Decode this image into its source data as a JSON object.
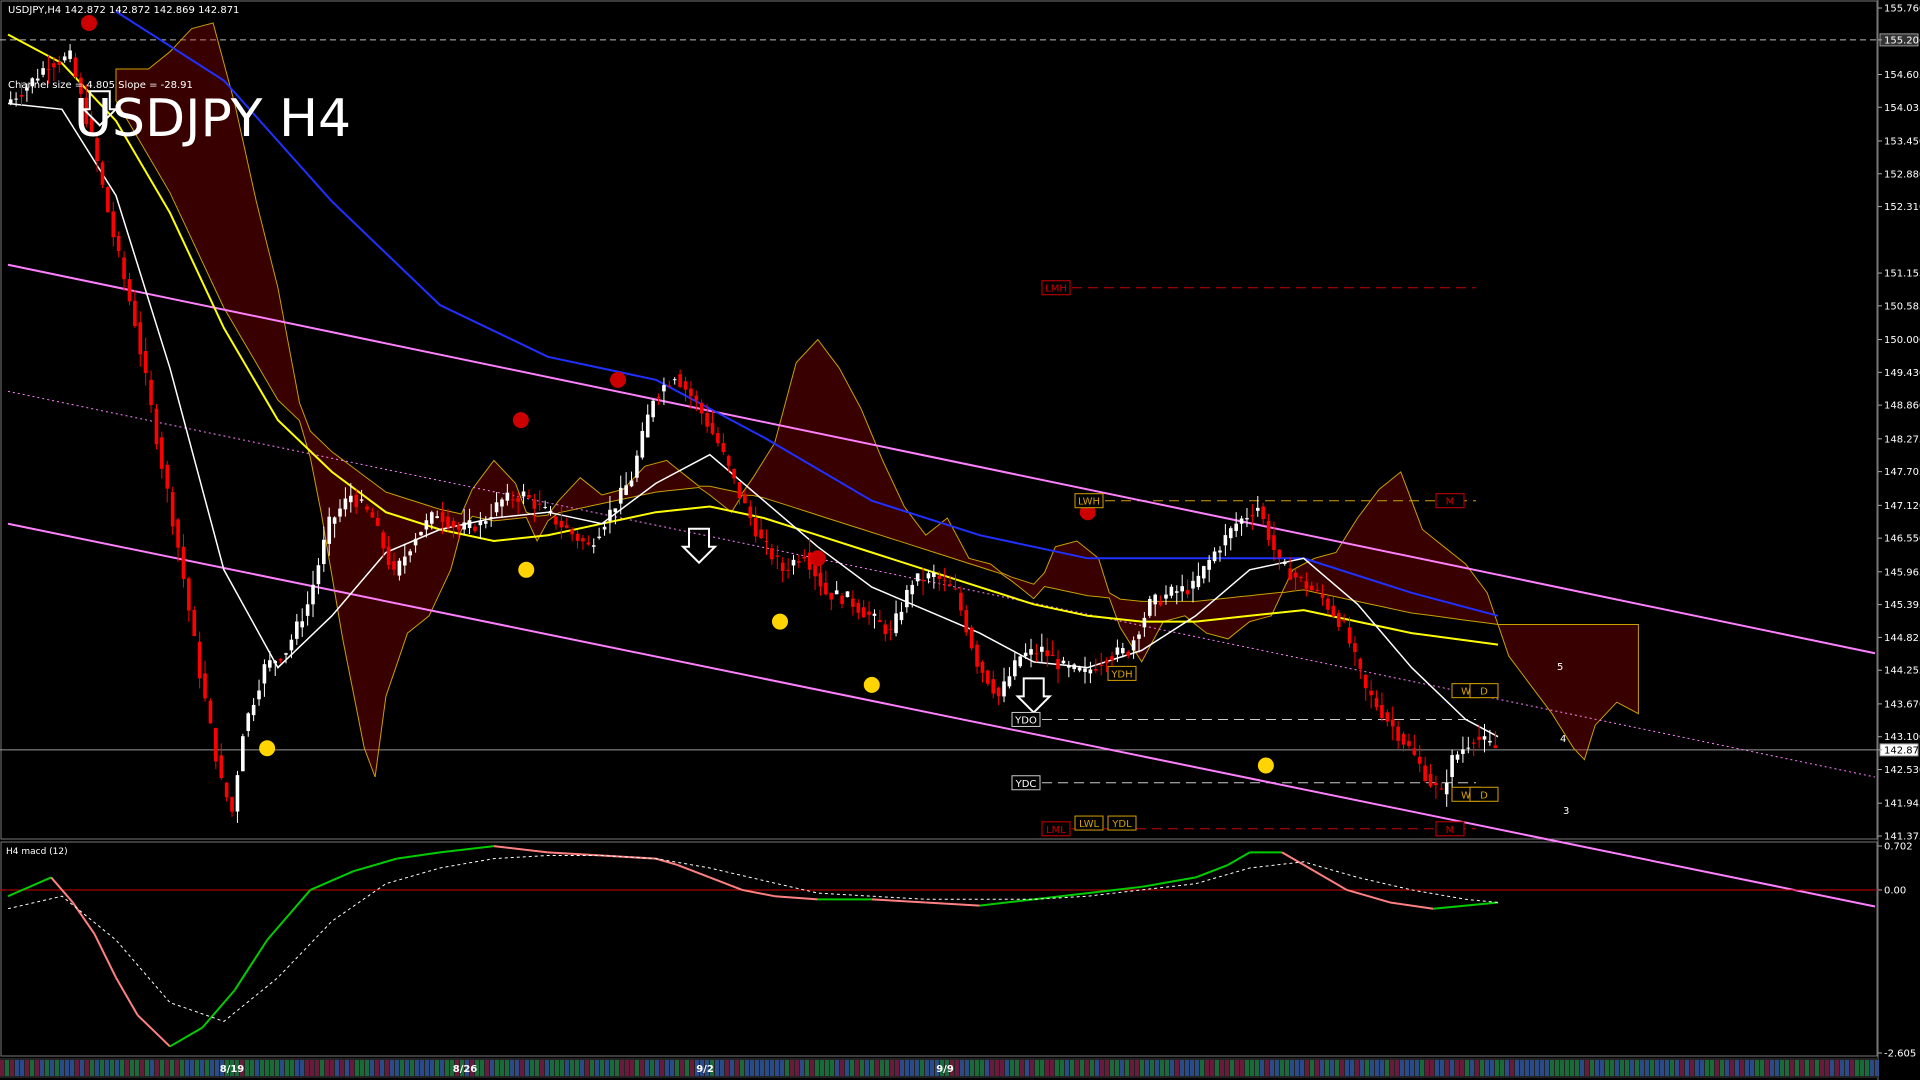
{
  "header": {
    "symbol_line": "USDJPY,H4  142.872 142.872 142.869 142.871",
    "channel_line": "Channel size = 4.805 Slope = -28.91",
    "big_title": "USDJPY H4"
  },
  "macd_panel": {
    "label": "H4  macd (12)"
  },
  "colors": {
    "background": "#000000",
    "bull_candle": "#ffffff",
    "bear_candle": "#ff0000",
    "ma_fast": "#ffffff",
    "ma_slow": "#ffff00",
    "ma_long": "#0000ff",
    "channel": "#ff80ff",
    "cloud": "#cc0000",
    "macd_up": "#00cc00",
    "macd_down": "#ff8080",
    "signal": "#ffffff",
    "axis_text": "#ffffff"
  },
  "chart_data": [
    {
      "type": "candlestick",
      "title": "USDJPY H4",
      "ylim": [
        141.375,
        155.76
      ],
      "current_price": 142.871,
      "price_axis_labels": [
        "155.760",
        "155.206",
        "154.605",
        "154.035",
        "153.450",
        "152.880",
        "152.310",
        "151.155",
        "150.585",
        "150.000",
        "149.430",
        "148.860",
        "148.275",
        "147.705",
        "147.120",
        "146.550",
        "145.965",
        "145.395",
        "144.825",
        "144.255",
        "143.670",
        "143.100",
        "142.871",
        "142.530",
        "141.945",
        "141.375"
      ],
      "highlighted_levels": [
        {
          "value": "155.206",
          "style": "dashed"
        },
        {
          "value": "142.871",
          "style": "current"
        }
      ],
      "date_labels": [
        "8/19",
        "8/26",
        "9/2",
        "9/9"
      ],
      "price_path": [
        [
          0,
          154.1
        ],
        [
          4,
          154.4
        ],
        [
          8,
          154.8
        ],
        [
          12,
          154.9
        ],
        [
          16,
          153.5
        ],
        [
          20,
          151.8
        ],
        [
          24,
          150.3
        ],
        [
          28,
          148.3
        ],
        [
          32,
          146.4
        ],
        [
          36,
          144.2
        ],
        [
          40,
          142.3
        ],
        [
          42,
          141.8
        ],
        [
          44,
          143.2
        ],
        [
          48,
          144.3
        ],
        [
          52,
          144.6
        ],
        [
          56,
          145.4
        ],
        [
          60,
          146.8
        ],
        [
          64,
          147.3
        ],
        [
          68,
          146.9
        ],
        [
          72,
          145.9
        ],
        [
          76,
          146.6
        ],
        [
          80,
          147.0
        ],
        [
          84,
          146.7
        ],
        [
          88,
          146.8
        ],
        [
          92,
          147.2
        ],
        [
          96,
          147.3
        ],
        [
          100,
          147.0
        ],
        [
          104,
          146.7
        ],
        [
          108,
          146.4
        ],
        [
          112,
          147.0
        ],
        [
          116,
          147.6
        ],
        [
          120,
          149.0
        ],
        [
          124,
          149.4
        ],
        [
          128,
          148.9
        ],
        [
          132,
          148.2
        ],
        [
          136,
          147.3
        ],
        [
          140,
          146.5
        ],
        [
          144,
          146.0
        ],
        [
          148,
          146.3
        ],
        [
          152,
          145.6
        ],
        [
          156,
          145.5
        ],
        [
          160,
          145.2
        ],
        [
          164,
          144.9
        ],
        [
          168,
          145.8
        ],
        [
          172,
          145.9
        ],
        [
          176,
          145.6
        ],
        [
          180,
          144.4
        ],
        [
          184,
          143.8
        ],
        [
          188,
          144.5
        ],
        [
          192,
          144.6
        ],
        [
          196,
          144.3
        ],
        [
          200,
          144.2
        ],
        [
          204,
          144.5
        ],
        [
          208,
          144.6
        ],
        [
          212,
          145.4
        ],
        [
          216,
          145.6
        ],
        [
          220,
          145.7
        ],
        [
          224,
          146.3
        ],
        [
          228,
          146.8
        ],
        [
          232,
          147.1
        ],
        [
          236,
          146.1
        ],
        [
          240,
          145.8
        ],
        [
          244,
          145.5
        ],
        [
          248,
          145.0
        ],
        [
          252,
          143.9
        ],
        [
          256,
          143.4
        ],
        [
          260,
          142.9
        ],
        [
          264,
          142.3
        ],
        [
          266,
          142.1
        ],
        [
          268,
          142.7
        ],
        [
          272,
          143.1
        ],
        [
          276,
          142.9
        ]
      ],
      "ma_fast": [
        [
          0,
          154.1
        ],
        [
          10,
          154.0
        ],
        [
          20,
          152.5
        ],
        [
          30,
          149.5
        ],
        [
          40,
          146.0
        ],
        [
          50,
          144.3
        ],
        [
          60,
          145.2
        ],
        [
          70,
          146.3
        ],
        [
          80,
          146.7
        ],
        [
          90,
          146.9
        ],
        [
          100,
          147.0
        ],
        [
          110,
          146.8
        ],
        [
          120,
          147.5
        ],
        [
          130,
          148.0
        ],
        [
          140,
          147.2
        ],
        [
          150,
          146.4
        ],
        [
          160,
          145.7
        ],
        [
          170,
          145.3
        ],
        [
          180,
          144.9
        ],
        [
          190,
          144.4
        ],
        [
          200,
          144.3
        ],
        [
          210,
          144.6
        ],
        [
          220,
          145.2
        ],
        [
          230,
          146.0
        ],
        [
          240,
          146.2
        ],
        [
          250,
          145.4
        ],
        [
          260,
          144.3
        ],
        [
          270,
          143.4
        ],
        [
          276,
          143.1
        ]
      ],
      "ma_slow": [
        [
          0,
          155.3
        ],
        [
          10,
          154.8
        ],
        [
          20,
          153.8
        ],
        [
          30,
          152.2
        ],
        [
          40,
          150.2
        ],
        [
          50,
          148.6
        ],
        [
          60,
          147.7
        ],
        [
          70,
          147.0
        ],
        [
          80,
          146.7
        ],
        [
          90,
          146.5
        ],
        [
          100,
          146.6
        ],
        [
          110,
          146.8
        ],
        [
          120,
          147.0
        ],
        [
          130,
          147.1
        ],
        [
          140,
          146.9
        ],
        [
          150,
          146.6
        ],
        [
          160,
          146.3
        ],
        [
          170,
          146.0
        ],
        [
          180,
          145.7
        ],
        [
          190,
          145.4
        ],
        [
          200,
          145.2
        ],
        [
          210,
          145.1
        ],
        [
          220,
          145.1
        ],
        [
          230,
          145.2
        ],
        [
          240,
          145.3
        ],
        [
          250,
          145.1
        ],
        [
          260,
          144.9
        ],
        [
          276,
          144.7
        ]
      ],
      "ma_long": [
        [
          20,
          155.7
        ],
        [
          40,
          154.5
        ],
        [
          60,
          152.4
        ],
        [
          80,
          150.6
        ],
        [
          100,
          149.7
        ],
        [
          120,
          149.3
        ],
        [
          140,
          148.3
        ],
        [
          160,
          147.2
        ],
        [
          180,
          146.6
        ],
        [
          200,
          146.2
        ],
        [
          220,
          146.2
        ],
        [
          240,
          146.2
        ],
        [
          260,
          145.6
        ],
        [
          276,
          145.2
        ]
      ],
      "channel_upper": [
        [
          0,
          151.3
        ],
        [
          276,
          144.9
        ]
      ],
      "channel_lower": [
        [
          0,
          146.8
        ],
        [
          276,
          140.5
        ]
      ],
      "channel_mid": [
        [
          0,
          149.1
        ],
        [
          276,
          142.7
        ]
      ],
      "annotations": [
        {
          "text": "LMH",
          "value": 150.9
        },
        {
          "text": "LWH",
          "value": 147.2
        },
        {
          "text": "M",
          "value": 147.2
        },
        {
          "text": "YDH",
          "value": 144.2
        },
        {
          "text": "YDO",
          "value": 143.4
        },
        {
          "text": "W",
          "value": 143.9
        },
        {
          "text": "D",
          "value": 143.9
        },
        {
          "text": "YDC",
          "value": 142.3
        },
        {
          "text": "W",
          "value": 142.1
        },
        {
          "text": "D",
          "value": 142.1
        },
        {
          "text": "LWL",
          "value": 141.6
        },
        {
          "text": "YDL",
          "value": 141.6
        },
        {
          "text": "LML",
          "value": 141.5
        },
        {
          "text": "M",
          "value": 141.5
        }
      ],
      "extra_labels": [
        "5",
        "4",
        "3"
      ]
    },
    {
      "type": "line",
      "title": "H4  macd (12)",
      "ylim": [
        -2.605,
        0.702
      ],
      "axis_labels": [
        "0.702",
        "0.00",
        "-2.605"
      ],
      "macd": [
        [
          0,
          -0.1
        ],
        [
          8,
          0.2
        ],
        [
          12,
          -0.2
        ],
        [
          16,
          -0.7
        ],
        [
          20,
          -1.4
        ],
        [
          24,
          -2.0
        ],
        [
          30,
          -2.5
        ],
        [
          36,
          -2.2
        ],
        [
          42,
          -1.6
        ],
        [
          48,
          -0.8
        ],
        [
          56,
          0.0
        ],
        [
          64,
          0.3
        ],
        [
          72,
          0.5
        ],
        [
          80,
          0.6
        ],
        [
          90,
          0.7
        ],
        [
          100,
          0.6
        ],
        [
          110,
          0.55
        ],
        [
          120,
          0.5
        ],
        [
          124,
          0.4
        ],
        [
          130,
          0.2
        ],
        [
          136,
          0.0
        ],
        [
          142,
          -0.1
        ],
        [
          150,
          -0.15
        ],
        [
          160,
          -0.15
        ],
        [
          170,
          -0.2
        ],
        [
          180,
          -0.25
        ],
        [
          190,
          -0.15
        ],
        [
          200,
          -0.05
        ],
        [
          210,
          0.05
        ],
        [
          220,
          0.2
        ],
        [
          226,
          0.4
        ],
        [
          230,
          0.6
        ],
        [
          236,
          0.6
        ],
        [
          242,
          0.3
        ],
        [
          248,
          0.0
        ],
        [
          256,
          -0.2
        ],
        [
          264,
          -0.3
        ],
        [
          270,
          -0.25
        ],
        [
          276,
          -0.2
        ]
      ],
      "signal": [
        [
          0,
          -0.3
        ],
        [
          10,
          -0.1
        ],
        [
          20,
          -0.8
        ],
        [
          30,
          -1.8
        ],
        [
          40,
          -2.1
        ],
        [
          50,
          -1.4
        ],
        [
          60,
          -0.5
        ],
        [
          70,
          0.1
        ],
        [
          80,
          0.35
        ],
        [
          90,
          0.5
        ],
        [
          100,
          0.55
        ],
        [
          110,
          0.55
        ],
        [
          120,
          0.5
        ],
        [
          130,
          0.35
        ],
        [
          140,
          0.15
        ],
        [
          150,
          -0.05
        ],
        [
          160,
          -0.1
        ],
        [
          170,
          -0.15
        ],
        [
          180,
          -0.15
        ],
        [
          190,
          -0.15
        ],
        [
          200,
          -0.1
        ],
        [
          210,
          0.0
        ],
        [
          220,
          0.1
        ],
        [
          230,
          0.35
        ],
        [
          240,
          0.45
        ],
        [
          250,
          0.2
        ],
        [
          260,
          0.0
        ],
        [
          270,
          -0.15
        ],
        [
          276,
          -0.2
        ]
      ]
    }
  ],
  "timeline": {
    "labels": [
      "8/19",
      "8/26",
      "9/2",
      "9/9"
    ]
  }
}
